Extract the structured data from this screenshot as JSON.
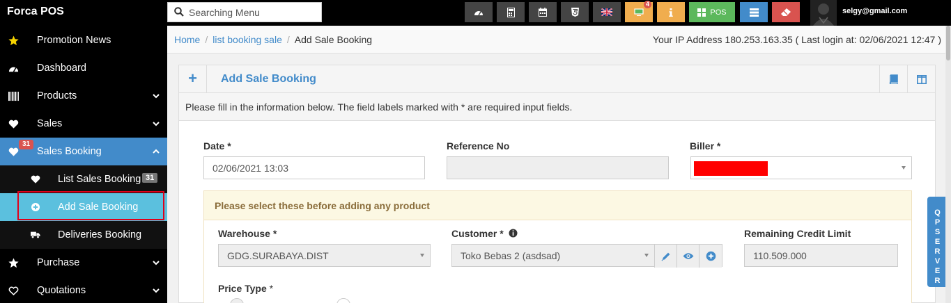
{
  "app": {
    "brand": "Forca POS"
  },
  "search": {
    "placeholder": "Searching Menu"
  },
  "toolbar": {
    "buttons": [
      {
        "icon": "dashboard-icon",
        "color": "#444444"
      },
      {
        "icon": "calculator-icon",
        "color": "#444444"
      },
      {
        "icon": "calendar-icon",
        "color": "#444444"
      },
      {
        "icon": "css3-icon",
        "color": "#444444"
      },
      {
        "icon": "uk-flag-icon",
        "color": "#444444"
      },
      {
        "icon": "monitor-icon",
        "color": "#f0ad4e",
        "badge": "4"
      },
      {
        "icon": "info-icon",
        "color": "#f0ad4e"
      },
      {
        "icon": "pos-icon",
        "color": "#5cb85c",
        "label": "POS"
      },
      {
        "icon": "list-icon",
        "color": "#428bca"
      },
      {
        "icon": "eraser-icon",
        "color": "#d9534f"
      }
    ],
    "user_email": "selgy@gmail.com"
  },
  "sidebar": {
    "items": [
      {
        "label": "Promotion News",
        "icon": "star-icon"
      },
      {
        "label": "Dashboard",
        "icon": "dashboard-icon"
      },
      {
        "label": "Products",
        "icon": "barcode-icon"
      },
      {
        "label": "Sales",
        "icon": "heart-icon"
      },
      {
        "label": "Sales Booking",
        "icon": "heart-icon",
        "badge": "31"
      },
      {
        "label": "List Sales Booking",
        "icon": "heart-icon",
        "count": "31"
      },
      {
        "label": "Add Sale Booking",
        "icon": "plus-circle-icon"
      },
      {
        "label": "Deliveries Booking",
        "icon": "truck-icon"
      },
      {
        "label": "Purchase",
        "icon": "star-icon"
      },
      {
        "label": "Quotations",
        "icon": "heart-outline-icon"
      }
    ]
  },
  "breadcrumb": {
    "home": "Home",
    "list": "list booking sale",
    "current": "Add Sale Booking",
    "ip_info": "Your IP Address 180.253.163.35 ( Last login at: 02/06/2021 12:47 )"
  },
  "panel": {
    "title": "Add Sale Booking",
    "intro": "Please fill in the information below. The field labels marked with * are required input fields."
  },
  "form": {
    "date_label": "Date *",
    "date_value": "02/06/2021 13:03",
    "ref_label": "Reference No",
    "ref_value": "",
    "biller_label": "Biller *",
    "notice": "Please select these before adding any product",
    "warehouse_label": "Warehouse *",
    "warehouse_value": "GDG.SURABAYA.DIST",
    "customer_label": "Customer *",
    "customer_value": "Toko Bebas 2 (asdsad)",
    "credit_label": "Remaining Credit Limit",
    "credit_value": "110.509.000",
    "price_type_label": "Price Type",
    "price_type_required": "*"
  },
  "qp_server": {
    "label": "QP SERVER"
  },
  "colors": {
    "accent": "#428bca",
    "active_sidebar": "#5bc0de",
    "highlight_border": "#e0001a"
  }
}
